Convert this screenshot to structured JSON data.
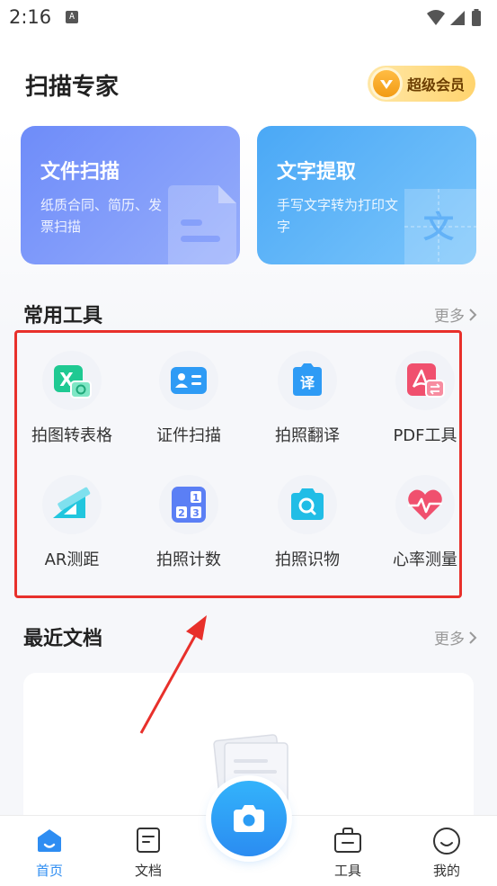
{
  "status_bar": {
    "time": "2:16",
    "notif_glyph": "A"
  },
  "header": {
    "title": "扫描专家",
    "vip_label": "超级会员"
  },
  "feature_cards": [
    {
      "title": "文件扫描",
      "desc": "纸质合同、简历、发票扫描",
      "icon": "document-icon"
    },
    {
      "title": "文字提取",
      "desc": "手写文字转为打印文字",
      "icon": "text-icon"
    }
  ],
  "tools_section": {
    "title": "常用工具",
    "more": "更多",
    "items": [
      {
        "label": "拍图转表格",
        "icon": "excel-camera-icon",
        "color": "#1fc992"
      },
      {
        "label": "证件扫描",
        "icon": "id-card-icon",
        "color": "#2e9bf5"
      },
      {
        "label": "拍照翻译",
        "icon": "translate-icon",
        "color": "#2e9bf5"
      },
      {
        "label": "PDF工具",
        "icon": "pdf-icon",
        "color": "#f0506e"
      },
      {
        "label": "AR测距",
        "icon": "ruler-icon",
        "color": "#21c6de"
      },
      {
        "label": "拍照计数",
        "icon": "counter-icon",
        "color": "#5b7ff5"
      },
      {
        "label": "拍照识物",
        "icon": "camera-search-icon",
        "color": "#21bde6"
      },
      {
        "label": "心率测量",
        "icon": "heart-rate-icon",
        "color": "#f0506e"
      }
    ]
  },
  "recent_section": {
    "title": "最近文档",
    "more": "更多"
  },
  "tab_bar": {
    "items": [
      {
        "label": "首页",
        "icon": "home-icon",
        "active": true
      },
      {
        "label": "文档",
        "icon": "document-icon",
        "active": false
      },
      {
        "label": "工具",
        "icon": "toolbox-icon",
        "active": false
      },
      {
        "label": "我的",
        "icon": "profile-icon",
        "active": false
      }
    ],
    "center": {
      "icon": "camera-icon"
    }
  },
  "colors": {
    "accent": "#2e8df2",
    "highlight_border": "#e8302b",
    "card_scan": "#7b95fa",
    "card_ocr": "#56b2f8"
  }
}
